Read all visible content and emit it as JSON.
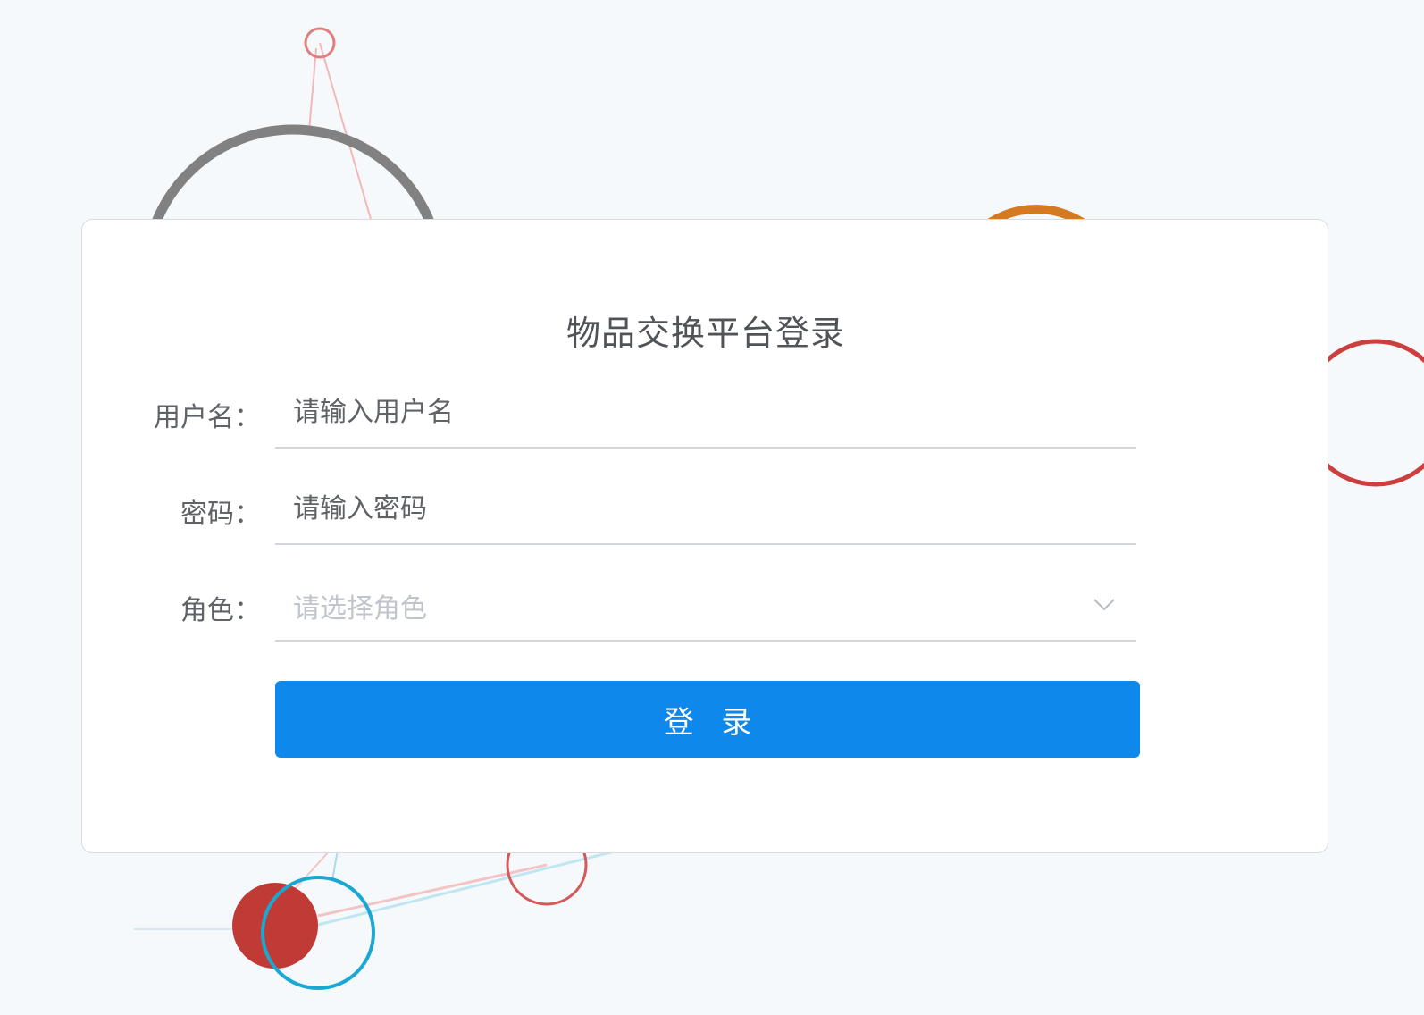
{
  "login": {
    "title": "物品交换平台登录",
    "username_label": "用户名：",
    "username_placeholder": "请输入用户名",
    "username_value": "",
    "password_label": "密码：",
    "password_placeholder": "请输入密码",
    "password_value": "",
    "role_label": "角色：",
    "role_placeholder": "请选择角色",
    "submit_label": "登 录"
  },
  "colors": {
    "primary": "#0e88ea",
    "background": "#f6f9fc",
    "card": "#ffffff",
    "label_text": "#5f6368",
    "placeholder_text": "#c0c4cc"
  },
  "icons": {
    "role_dropdown": "chevron-down-icon"
  }
}
